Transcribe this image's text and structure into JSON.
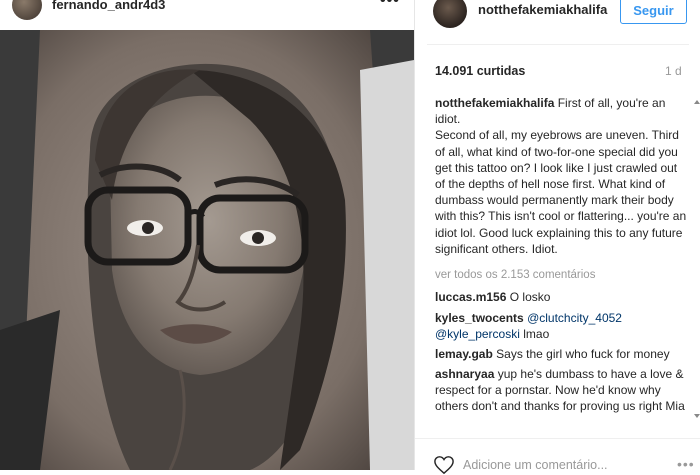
{
  "post": {
    "author": "fernando_andr4d3",
    "more_icon": "ellipsis-icon",
    "more_label": "•••"
  },
  "sidebar": {
    "username": "notthefakemiakhalifa",
    "follow_label": "Seguir",
    "likes": "14.091 curtidas",
    "age": "1 d",
    "caption_author": "notthefakemiakhalifa",
    "caption_lines": [
      "First of all, you're an idiot.",
      "Second of all, my eyebrows are uneven. Third of all, what kind of two-for-one special did you get this tattoo on? I look like I just crawled out of the depths of hell nose first. What kind of dumbass would permanently mark their body with this? This isn't cool or flattering... you're an idiot lol. Good luck explaining this to any future significant others. Idiot."
    ],
    "view_all": "ver todos os 2.153 comentários",
    "comments": [
      {
        "user": "luccas.m156",
        "text": "O losko"
      },
      {
        "user": "kyles_twocents",
        "mention1": "@clutchcity_4052",
        "mention2": "@kyle_percoski",
        "text": "lmao"
      },
      {
        "user": "lemay.gab",
        "text": "Says the girl who fuck for money"
      },
      {
        "user": "ashnaryaa",
        "text": "yup he's dumbass to have a love & respect for a pornstar. Now he'd know why others don't and thanks for proving us right Mia"
      }
    ],
    "add_comment_placeholder": "Adicione um comentário...",
    "heart_icon": "heart-outline-icon",
    "options_label": "•••"
  }
}
